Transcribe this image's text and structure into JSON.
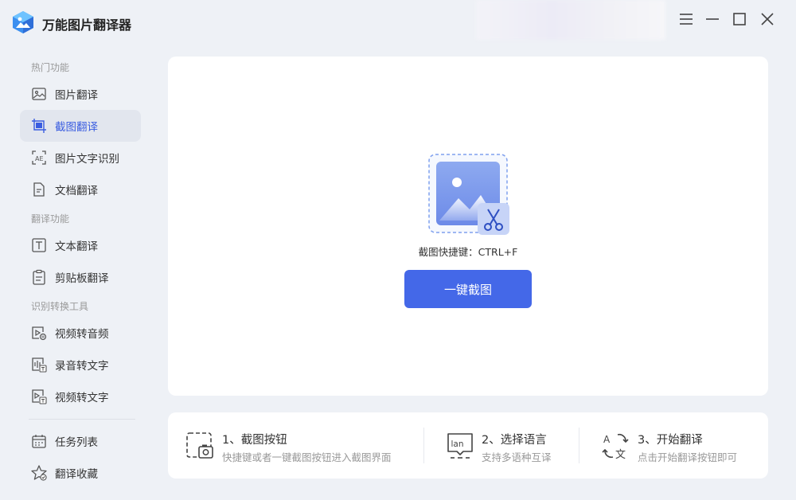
{
  "app": {
    "title": "万能图片翻译器",
    "accent_color": "#4468e8"
  },
  "window_controls": [
    {
      "name": "menu-icon"
    },
    {
      "name": "minimize-icon"
    },
    {
      "name": "maximize-icon"
    },
    {
      "name": "close-icon"
    }
  ],
  "sidebar": {
    "sections": [
      {
        "title": "热门功能"
      },
      {
        "title": "翻译功能"
      },
      {
        "title": "识别转换工具"
      }
    ],
    "items": [
      {
        "label": "图片翻译",
        "icon": "image-icon"
      },
      {
        "label": "截图翻译",
        "icon": "screenshot-icon",
        "active": true
      },
      {
        "label": "图片文字识别",
        "icon": "ocr-icon"
      },
      {
        "label": "文档翻译",
        "icon": "document-icon"
      },
      {
        "label": "文本翻译",
        "icon": "text-icon"
      },
      {
        "label": "剪贴板翻译",
        "icon": "clipboard-icon"
      },
      {
        "label": "视频转音频",
        "icon": "video-audio-icon"
      },
      {
        "label": "录音转文字",
        "icon": "recording-text-icon"
      },
      {
        "label": "视频转文字",
        "icon": "video-text-icon"
      },
      {
        "label": "任务列表",
        "icon": "calendar-icon"
      },
      {
        "label": "翻译收藏",
        "icon": "star-icon"
      }
    ]
  },
  "main": {
    "hotkey_text": "截图快捷键：CTRL+F",
    "capture_button_label": "一键截图"
  },
  "steps": [
    {
      "title": "1、截图按钮",
      "desc": "快捷键或者一键截图按钮进入截图界面",
      "icon": "screenshot-camera-icon"
    },
    {
      "title": "2、选择语言",
      "desc": "支持多语种互译",
      "icon": "language-icon"
    },
    {
      "title": "3、开始翻译",
      "desc": "点击开始翻译按钮即可",
      "icon": "translate-icon"
    }
  ]
}
